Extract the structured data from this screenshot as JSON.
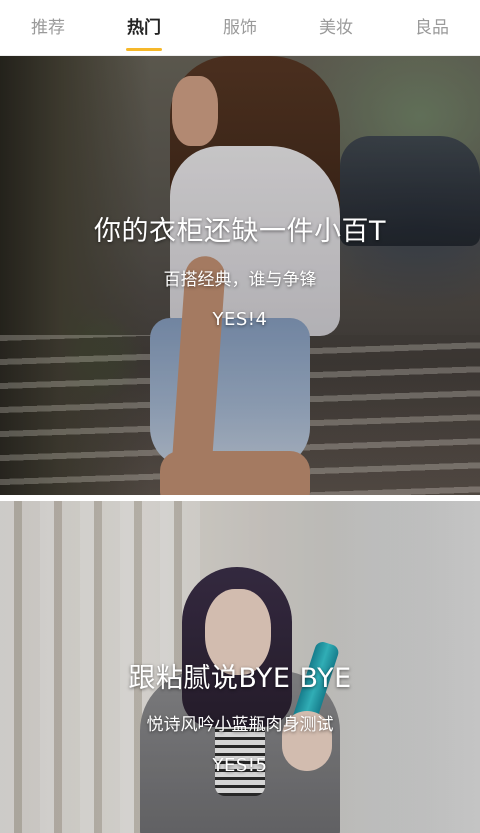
{
  "tabs": [
    {
      "label": "推荐",
      "active": false
    },
    {
      "label": "热门",
      "active": true
    },
    {
      "label": "服饰",
      "active": false
    },
    {
      "label": "美妆",
      "active": false
    },
    {
      "label": "良品",
      "active": false
    }
  ],
  "colors": {
    "accent": "#f6b82a",
    "inactive_tab": "#9a9a9a",
    "active_tab": "#222222"
  },
  "feed": [
    {
      "title": "你的衣柜还缺一件小百T",
      "subtitle": "百搭经典，谁与争锋",
      "count": "YES!4"
    },
    {
      "title": "跟粘腻说BYE BYE",
      "subtitle": "悦诗风吟小蓝瓶肉身测试",
      "count": "YES!5"
    }
  ]
}
